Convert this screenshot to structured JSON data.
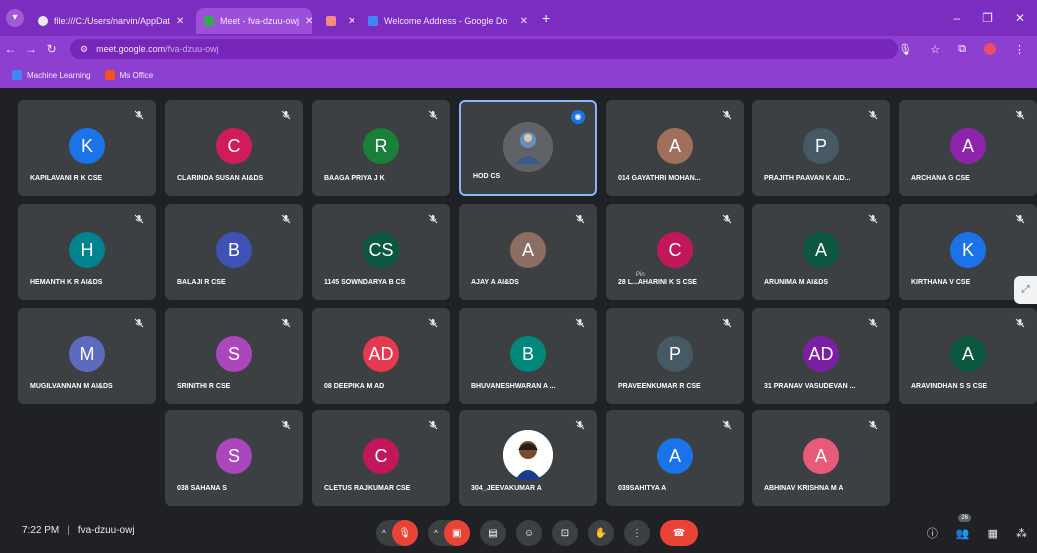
{
  "browser": {
    "tabs": [
      {
        "label": "file:///C:/Users/narvin/AppDat",
        "favicon_color": "#e8eaed"
      },
      {
        "label": "Meet - fva-dzuu-owj",
        "favicon_color": "#34a853"
      },
      {
        "label": "",
        "favicon_color": "#f28b82"
      },
      {
        "label": "Welcome Address - Google Do",
        "favicon_color": "#4285f4"
      }
    ],
    "url_host": "meet.google.com",
    "url_path": "/fva-dzuu-owj",
    "bookmarks": [
      {
        "label": "Machine Learning",
        "icon_color": "#4285f4"
      },
      {
        "label": "Ms Office",
        "icon_color": "#f4511e"
      }
    ]
  },
  "participants": [
    {
      "initials": "K",
      "name": "KAPILAVANI R K CSE",
      "color": "#1a73e8"
    },
    {
      "initials": "C",
      "name": "CLARINDA SUSAN AI&DS",
      "color": "#d01c5b"
    },
    {
      "initials": "R",
      "name": "BAAGA PRIYA J K",
      "color": "#188038"
    },
    {
      "initials": "",
      "name": "HOD CS",
      "color": "#5f6368"
    },
    {
      "initials": "A",
      "name": "014 GAYATHRI MOHAN...",
      "color": "#a1705d"
    },
    {
      "initials": "P",
      "name": "PRAJITH PAAVAN K AID...",
      "color": "#455a64"
    },
    {
      "initials": "A",
      "name": "ARCHANA G CSE",
      "color": "#8e24aa"
    },
    {
      "initials": "H",
      "name": "HEMANTH K R AI&DS",
      "color": "#00838f"
    },
    {
      "initials": "B",
      "name": "BALAJI R CSE",
      "color": "#3f51b5"
    },
    {
      "initials": "CS",
      "name": "1145 SOWNDARYA B CS",
      "color": "#0b5740"
    },
    {
      "initials": "A",
      "name": "AJAY A AI&DS",
      "color": "#8d6e63"
    },
    {
      "initials": "C",
      "name": "28 L...AHARINI K S CSE",
      "color": "#c2185b"
    },
    {
      "initials": "A",
      "name": "ARUNIMA M AI&DS",
      "color": "#0b5740"
    },
    {
      "initials": "K",
      "name": "KIRTHANA V CSE",
      "color": "#1a73e8"
    },
    {
      "initials": "M",
      "name": "MUGILVANNAN M AI&DS",
      "color": "#5c6bc0"
    },
    {
      "initials": "S",
      "name": "SRINITHI R CSE",
      "color": "#ab47bc"
    },
    {
      "initials": "AD",
      "name": "08 DEEPIKA M AD",
      "color": "#e53950"
    },
    {
      "initials": "B",
      "name": "BHUVANESHWARAN A ...",
      "color": "#00897b"
    },
    {
      "initials": "P",
      "name": "PRAVEENKUMAR R CSE",
      "color": "#455a64"
    },
    {
      "initials": "AD",
      "name": "31 PRANAV VASUDEVAN ...",
      "color": "#7b1fa2"
    },
    {
      "initials": "A",
      "name": "ARAVINDHAN S S CSE",
      "color": "#0b5740"
    },
    {
      "initials": "S",
      "name": "038 SAHANA S",
      "color": "#ab47bc"
    },
    {
      "initials": "C",
      "name": "CLETUS RAJKUMAR CSE",
      "color": "#c2185b"
    },
    {
      "initials": "",
      "name": "304_JEEVAKUMAR A",
      "color": "#ffffff"
    },
    {
      "initials": "A",
      "name": "039SAHITYA A",
      "color": "#1a73e8"
    },
    {
      "initials": "A",
      "name": "ABHINAV KRISHNA M A",
      "color": "#e85a7a"
    }
  ],
  "pin_hint": "Pin",
  "bottom": {
    "time": "7:22 PM",
    "meeting_code": "fva-dzuu-owj",
    "participant_badge": "26"
  }
}
